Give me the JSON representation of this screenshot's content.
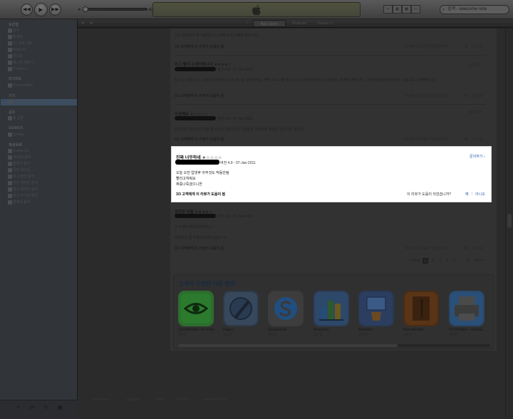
{
  "toolbar": {
    "back": "◀◀",
    "play": "▶",
    "forward": "▶▶",
    "search_value": "검색 - awesome note"
  },
  "sidebar": {
    "sections": [
      {
        "header": "보관함",
        "items": [
          "음악",
          "동영상",
          "TV 프로그램",
          "Podcast",
          "라디오",
          "벨소리 만들기",
          "iTunes U"
        ]
      },
      {
        "header": "STORE",
        "items": [
          "iTunes Store"
        ]
      },
      {
        "header": "기기",
        "items": [
          "wooky70의 iPhone"
        ]
      },
      {
        "header": "공유",
        "items": [
          "홈 공유"
        ]
      },
      {
        "header": "GENIUS",
        "items": [
          "Genius"
        ]
      },
      {
        "header": "재생목록",
        "items": [
          "iTunes DJ",
          "90년대 음악",
          "클래식 음악",
          "뮤직 비디오",
          "최고 평점 음악",
          "자주 재생한 음악",
          "최근 재생한 음악",
          "최근 추가된 항목",
          "클래식 음악"
        ]
      }
    ]
  },
  "store_tabs": {
    "app_store": "App Store",
    "podcast": "Podcast",
    "itunes_u": "iTunes U"
  },
  "reviews": [
    {
      "partial_text": "서도 업데이트 후 버들입니다. 대체 어케 어쩌란 말인가요..",
      "helpful": "4/4 고객에게 이 리뷰가 도움이 됨",
      "ask": "이 리뷰가 도움이 되었습니까?",
      "yes": "예",
      "no": "아니오"
    },
    {
      "title": "버그 빨리 수정바랍니다",
      "stars": "★★★★☆",
      "meta": "버전 4.9 - 07-Jan-2011",
      "body": "잘 쓰고 있습니다. 근데 이번 업데이트 후 버그를 발견했어요. 하전 프로그램 접근하셔 중에 업데이트를 완료했지, 침해이 반합니다. 그냥 비움하면 무리없을 거보 회도 수정해줍니다",
      "helpful": "3/3 고객에게 이 리뷰가 도움이 됨",
      "report": "문의하기",
      "ask": "이 리뷰가 도움이 되었습니까?",
      "yes": "예",
      "no": "아니오"
    },
    {
      "title": "이상해요",
      "stars": "★☆☆☆☆",
      "meta": "버전 4.9 - 07-Jan-2011",
      "body": "업데이트 하고나서 처음 앱 시작 시 정리하지 이원번호 입력하면 화면이 넘어가지 않아요",
      "helpful": "3/3 고객에게 이 리뷰가 도움이 됨",
      "report": "문의하기",
      "ask": "이 리뷰가 도움이 되었습니까?",
      "yes": "예",
      "no": "아니오"
    },
    {
      "title": "진짜 너무하네",
      "stars": "★☆☆☆☆",
      "meta": "버전 4.9 - 07-Jan-2011",
      "body": [
        "오늘 오전 업댓후 아무것도 작동안됨",
        "빨리고쳐줘요",
        "짜증나죽겠으니깐"
      ],
      "helpful": "3/3 고객에게 이 리뷰가 도움이 됨",
      "report": "문의하기",
      "ask": "이 리뷰가 도움이 되었습니까?",
      "yes": "예",
      "no": "아니오"
    },
    {
      "title": "업댓후 먹통",
      "stars": "★★★★☆",
      "meta": "버전 4.9 - 07-Jan-2011",
      "body": [
        "이거 빨리 해결해주세요 ㅠ",
        "메일로는 좀 이용안되네요 답끝ㅠㅠ"
      ],
      "helpful": "3/3 고객에게 이 리뷰가 도움이 됨",
      "ask": "이 리뷰가 도움이 되었습니까?",
      "yes": "예",
      "no": "아니오"
    }
  ],
  "pager": {
    "prev": "< Back",
    "pages": [
      "1",
      "2",
      "3",
      "4",
      "5",
      "...",
      "10"
    ],
    "next": "Next >"
  },
  "also_bought": {
    "title": "고객이 구매한 다른 항목",
    "apps": [
      {
        "name": "GoodReader for iPad",
        "category": "생산성",
        "icon": "eye-icon",
        "color": "#2f8a2f"
      },
      {
        "name": "Pages",
        "category": "생산성",
        "icon": "pen-icon",
        "color": "#3a5f8c"
      },
      {
        "name": "Simplenote",
        "category": "생산성",
        "icon": "s-icon",
        "color": "#2a7ec8"
      },
      {
        "name": "Numbers",
        "category": "생산성",
        "icon": "bar-chart-icon",
        "color": "#3e7ab8"
      },
      {
        "name": "Keynote",
        "category": "생산성",
        "icon": "podium-icon",
        "color": "#3a5a90"
      },
      {
        "name": "Penultimate",
        "category": "생산성",
        "icon": "notebook-icon",
        "color": "#7a4a22"
      },
      {
        "name": "ACTPrinter - Virtual...",
        "category": "생산성",
        "icon": "printer-icon",
        "color": "#3c80c0"
      }
    ]
  },
  "footer": [
    "iTunes Store",
    "App Store",
    "활성화",
    "기프트 카드",
    "Genius 추천 사용"
  ]
}
